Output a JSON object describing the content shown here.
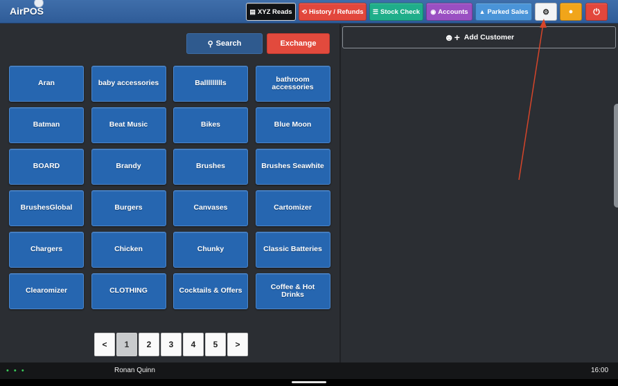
{
  "app": {
    "title": "AirPOS"
  },
  "toolbar": {
    "xyz_reads": "XYZ Reads",
    "history_refunds": "History / Refunds",
    "stock_check": "Stock Check",
    "accounts": "Accounts",
    "parked_sales": "Parked Sales"
  },
  "actions": {
    "search": "Search",
    "exchange": "Exchange",
    "add_customer": "Add Customer"
  },
  "categories": [
    "Aran",
    "baby accessories",
    "Ballllllllls",
    "bathroom accessories",
    "Batman",
    "Beat Music",
    "Bikes",
    "Blue Moon",
    "BOARD",
    "Brandy",
    "Brushes",
    "Brushes Seawhite",
    "BrushesGlobal",
    "Burgers",
    "Canvases",
    "Cartomizer",
    "Chargers",
    "Chicken",
    "Chunky",
    "Classic Batteries",
    "Clearomizer",
    "CLOTHING",
    "Cocktails & Offers",
    "Coffee & Hot Drinks"
  ],
  "pagination": {
    "prev": "<",
    "pages": [
      "1",
      "2",
      "3",
      "4",
      "5"
    ],
    "next": ">",
    "current": "1"
  },
  "status": {
    "user": "Ronan Quinn",
    "time": "16:00",
    "dots": "• • •"
  },
  "colors": {
    "topbar": "#3366a3",
    "category": "#2666b0",
    "exchange": "#e24a3d",
    "history": "#e2473c",
    "stock": "#1fae8a",
    "accounts": "#9a4fc2",
    "parked": "#4a94d8",
    "user_btn": "#f1a51a",
    "arrow": "#d6452a"
  },
  "icons": {
    "xyz_reads": "receipt-icon",
    "history": "history-icon",
    "stock": "list-icon",
    "accounts": "users-icon",
    "parked": "road-icon",
    "settings": "gear-icon",
    "user": "user-icon",
    "power": "power-icon",
    "search": "search-icon",
    "add_customer": "user-plus-icon"
  }
}
